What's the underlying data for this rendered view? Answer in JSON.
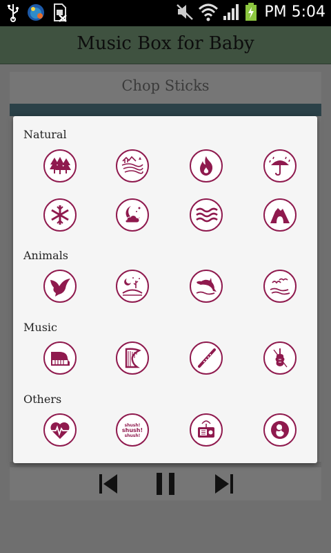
{
  "status_bar": {
    "am_pm": "PM",
    "time": "5:04",
    "icons": [
      "usb-icon",
      "app-notification-icon",
      "no-sim-icon",
      "mute-icon",
      "wifi-icon",
      "signal-icon",
      "battery-charging-icon"
    ]
  },
  "app": {
    "title": "Music Box for Baby"
  },
  "player": {
    "track_title": "Chop Sticks",
    "controls": [
      "previous-icon",
      "pause-icon",
      "next-icon"
    ]
  },
  "dialog": {
    "sections": [
      {
        "label": "Natural",
        "items": [
          "forest-icon",
          "stream-icon",
          "fire-icon",
          "rain-icon",
          "snowflake-icon",
          "night-icon",
          "waves-icon",
          "cave-icon"
        ]
      },
      {
        "label": "Animals",
        "items": [
          "bird-icon",
          "night-insects-icon",
          "dolphin-icon",
          "seagulls-icon"
        ]
      },
      {
        "label": "Music",
        "items": [
          "piano-icon",
          "harp-icon",
          "flute-icon",
          "violin-icon"
        ]
      },
      {
        "label": "Others",
        "items": [
          "heartbeat-icon",
          "shush-icon",
          "radio-icon",
          "womb-icon"
        ]
      }
    ],
    "shush_text": "shush!"
  },
  "colors": {
    "accent": "#8f1a4e",
    "dialog_bg": "#f5f5f5",
    "app_bar": "#3f5240"
  }
}
